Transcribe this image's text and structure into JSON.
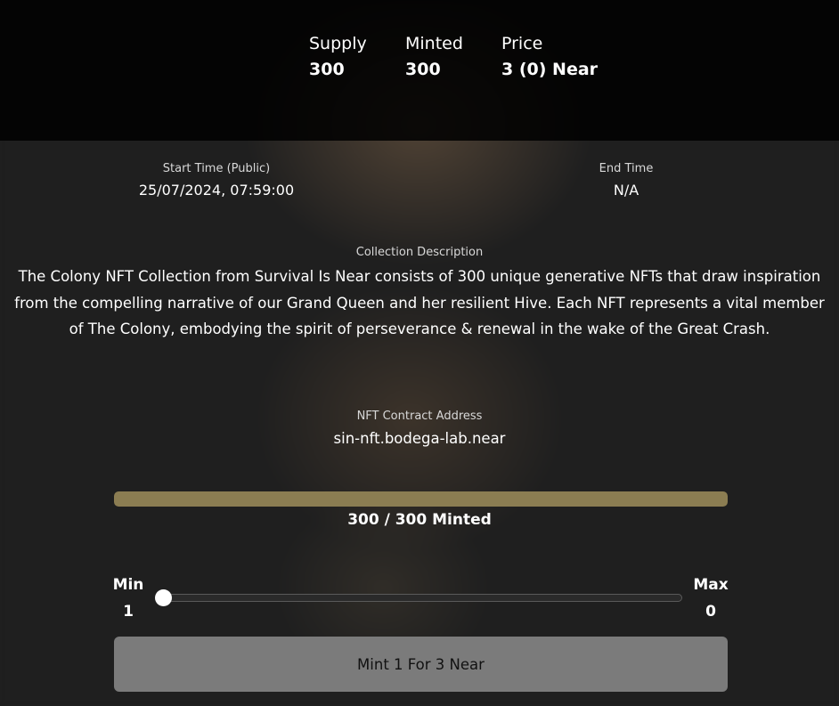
{
  "stats": {
    "supply_label": "Supply",
    "supply_value": "300",
    "minted_label": "Minted",
    "minted_value": "300",
    "price_label": "Price",
    "price_value": "3 (0) Near"
  },
  "times": {
    "start_label": "Start Time (Public)",
    "start_value": "25/07/2024, 07:59:00",
    "end_label": "End Time",
    "end_value": "N/A"
  },
  "collection": {
    "description_label": "Collection Description",
    "description": "The Colony NFT Collection from Survival Is Near consists of 300 unique generative NFTs that draw inspiration from the compelling narrative of our Grand Queen and her resilient Hive. Each NFT represents a vital member of The Colony, embodying the spirit of perseverance & renewal in the wake of the Great Crash."
  },
  "contract": {
    "label": "NFT Contract Address",
    "address": "sin-nft.bodega-lab.near"
  },
  "progress": {
    "minted": 300,
    "total": 300,
    "text": "300 / 300 Minted",
    "fill_color": "#8b7d52"
  },
  "quantity": {
    "min_label": "Min",
    "min_value": "1",
    "max_label": "Max",
    "max_value": "0",
    "current": 1
  },
  "mint_button": {
    "label": "Mint 1 For 3 Near"
  }
}
